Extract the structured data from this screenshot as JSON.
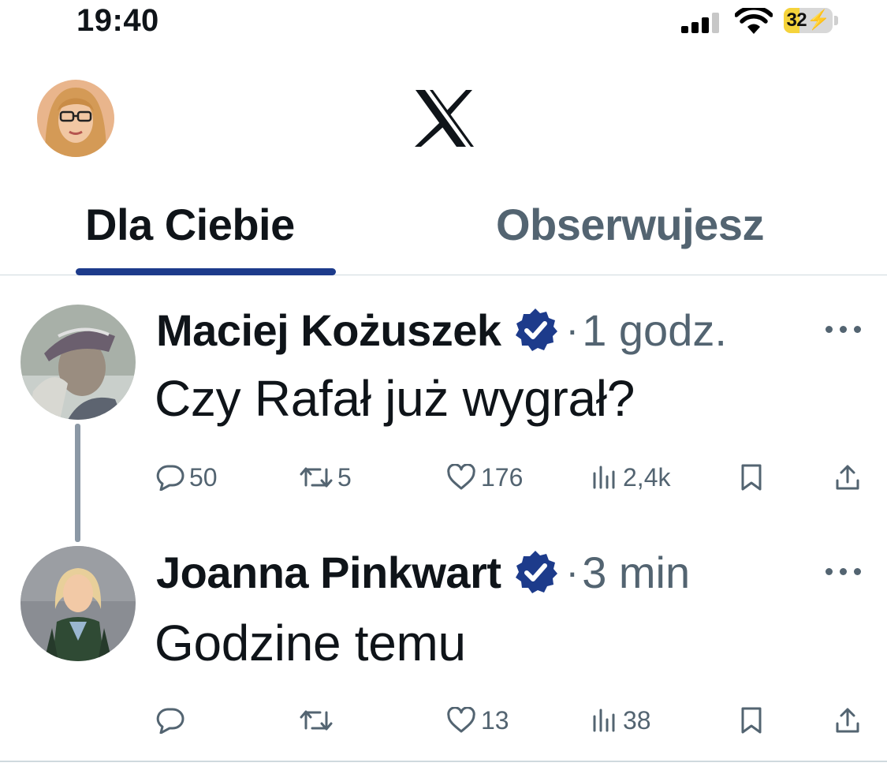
{
  "status_bar": {
    "time": "19:40",
    "battery": {
      "text": "32",
      "level": 0.32,
      "charging": true
    },
    "icons": [
      "signal-icon",
      "wifi-icon",
      "battery-icon"
    ]
  },
  "header": {
    "logo": "x-logo-icon"
  },
  "tabs": [
    {
      "label": "Dla Ciebie",
      "active": true
    },
    {
      "label": "Obserwujesz",
      "active": false
    }
  ],
  "tweets": [
    {
      "author": "Maciej Kożuszek",
      "verified": true,
      "separator": "·",
      "time": "1 godz.",
      "text": "Czy Rafał już wygrał?",
      "replies": "50",
      "reposts": "5",
      "likes": "176",
      "views": "2,4k"
    },
    {
      "author": "Joanna Pinkwart",
      "verified": true,
      "separator": "·",
      "time": "3 min",
      "text": "Godzine temu",
      "replies": "",
      "reposts": "",
      "likes": "13",
      "views": "38"
    }
  ],
  "colors": {
    "accent_tab": "#1d3b8b",
    "verified_badge": "#1d3b8b",
    "text_primary": "#0f1419",
    "text_secondary": "#536471",
    "battery_fill": "#f5d33b"
  }
}
